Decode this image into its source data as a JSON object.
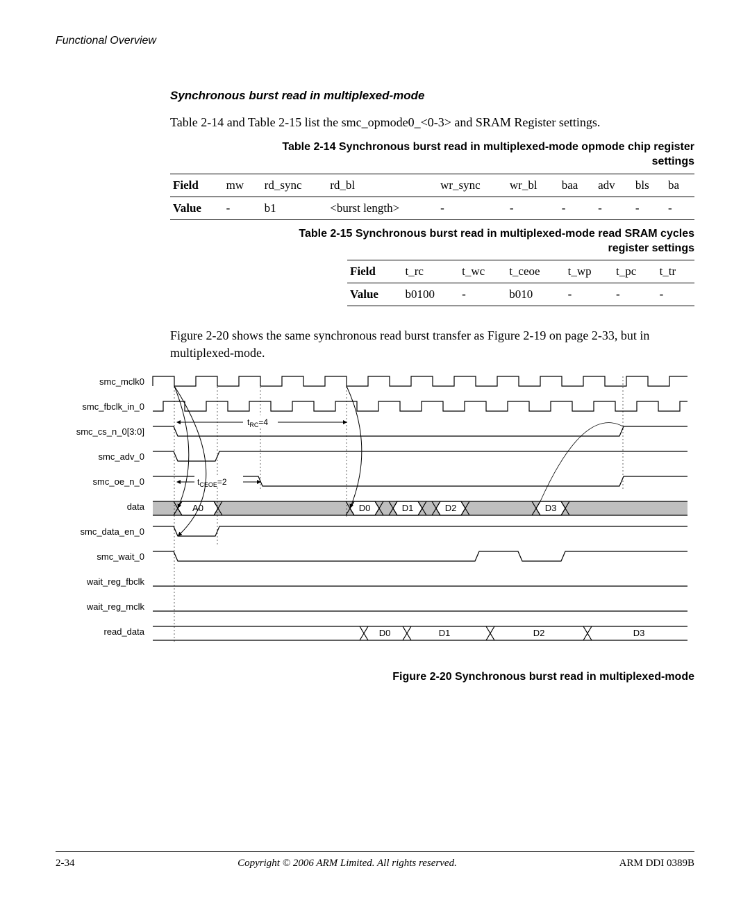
{
  "page_header": "Functional Overview",
  "section_title": "Synchronous burst read in multiplexed-mode",
  "intro_text": "Table 2-14 and Table 2-15 list the smc_opmode0_<0-3> and SRAM Register settings.",
  "table1": {
    "caption_line1": "Table 2-14 Synchronous burst read in multiplexed-mode opmode chip register",
    "caption_line2": "settings",
    "field_label": "Field",
    "value_label": "Value",
    "cols": [
      "mw",
      "rd_sync",
      "rd_bl",
      "wr_sync",
      "wr_bl",
      "baa",
      "adv",
      "bls",
      "ba"
    ],
    "vals": [
      "-",
      "b1",
      "<burst length>",
      "-",
      "-",
      "-",
      "-",
      "-",
      "-"
    ]
  },
  "table2": {
    "caption_line1": "Table 2-15 Synchronous burst read in multiplexed-mode read SRAM cycles",
    "caption_line2": "register settings",
    "field_label": "Field",
    "value_label": "Value",
    "cols": [
      "t_rc",
      "t_wc",
      "t_ceoe",
      "t_wp",
      "t_pc",
      "t_tr"
    ],
    "vals": [
      "b0100",
      "-",
      "b010",
      "-",
      "-",
      "-"
    ]
  },
  "mid_text": "Figure 2-20 shows the same synchronous read burst transfer as Figure 2-19 on page 2-33, but in multiplexed-mode.",
  "figure": {
    "caption": "Figure 2-20 Synchronous burst read in multiplexed-mode",
    "signals": [
      "smc_mclk0",
      "smc_fbclk_in_0",
      "smc_cs_n_0[3:0]",
      "smc_adv_0",
      "smc_oe_n_0",
      "data",
      "smc_data_en_0",
      "smc_wait_0",
      "wait_reg_fbclk",
      "wait_reg_mclk",
      "read_data"
    ],
    "t_rc_label": "t",
    "t_rc_sub": "RC",
    "t_rc_val": "=4",
    "t_ceoe_label": "t",
    "t_ceoe_sub": "CEOE",
    "t_ceoe_val": "=2",
    "data_vals": [
      "A0",
      "D0",
      "D1",
      "D2",
      "D3"
    ],
    "read_data_vals": [
      "D0",
      "D1",
      "D2",
      "D3"
    ]
  },
  "footer": {
    "left": "2-34",
    "center": "Copyright © 2006 ARM Limited. All rights reserved.",
    "right": "ARM DDI 0389B"
  }
}
